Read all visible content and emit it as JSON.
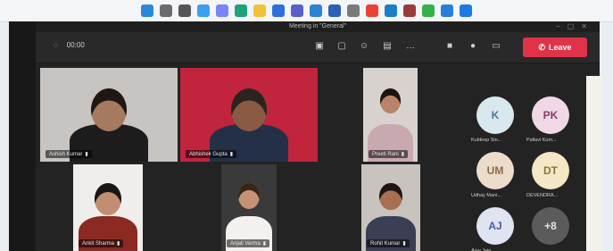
{
  "taskbar": {
    "icons": [
      {
        "name": "windows-icon",
        "color": "#2b88d8"
      },
      {
        "name": "search-icon",
        "color": "#6b6b6b"
      },
      {
        "name": "task-view-icon",
        "color": "#555555"
      },
      {
        "name": "widgets-icon",
        "color": "#3aa0f2"
      },
      {
        "name": "chat-icon",
        "color": "#7a86f5"
      },
      {
        "name": "edge-icon",
        "color": "#1ea27a"
      },
      {
        "name": "file-explorer-icon",
        "color": "#f2c13a"
      },
      {
        "name": "store-icon",
        "color": "#2f6fd8"
      },
      {
        "name": "teams-icon",
        "color": "#5a5fc8"
      },
      {
        "name": "mail-icon",
        "color": "#2c82d6"
      },
      {
        "name": "word-icon",
        "color": "#2b5fb8"
      },
      {
        "name": "settings-icon",
        "color": "#7a7a7a"
      },
      {
        "name": "chrome-icon",
        "color": "#e94235"
      },
      {
        "name": "photos-icon",
        "color": "#1b7fc4"
      },
      {
        "name": "app-icon",
        "color": "#9b3a3a"
      },
      {
        "name": "whatsapp-icon",
        "color": "#34b24a"
      },
      {
        "name": "media-icon",
        "color": "#2680d8"
      },
      {
        "name": "maps-icon",
        "color": "#1c7be0"
      }
    ]
  },
  "window": {
    "title": "Meeting in \"General\"",
    "timer": "00:00",
    "leave_label": "Leave"
  },
  "participants": [
    {
      "name": "Ashish Kumar",
      "skin": "#a57a5e",
      "hair": "#1e1714",
      "shirt": "#1c1c1c",
      "bg": "#c7c4c2"
    },
    {
      "name": "Abhishek Gupta",
      "skin": "#8a5a44",
      "hair": "#2a2420",
      "shirt": "#243048",
      "bg": "#c1243d"
    },
    {
      "name": "Preeti Rani",
      "skin": "#b98368",
      "hair": "#1c1410",
      "shirt": "#c9a9b0",
      "bg": "#d8d2cf"
    },
    {
      "name": "Ankit Sharma",
      "skin": "#c28e73",
      "hair": "#1a1614",
      "shirt": "#8a2a22",
      "bg": "#f0eeec"
    },
    {
      "name": "Anjali Verma",
      "skin": "#c59276",
      "hair": "#3a2619",
      "shirt": "#f3f0ee",
      "bg": "#3a3a3a"
    },
    {
      "name": "Rohit Kumar",
      "skin": "#a86f52",
      "hair": "#1d1714",
      "shirt": "#3a3f56",
      "bg": "#c9c3bf"
    }
  ],
  "roster": [
    {
      "initials": "K",
      "label": "Kuldeep Sin...",
      "bg": "#d9e7ef",
      "fg": "#4a7a96"
    },
    {
      "initials": "PK",
      "label": "Pallavi Kum...",
      "bg": "#f0d8e6",
      "fg": "#8a3d6b"
    },
    {
      "initials": "UM",
      "label": "Udhay Mani...",
      "bg": "#ecdccc",
      "fg": "#8a6a46"
    },
    {
      "initials": "DT",
      "label": "DEVENDRA...",
      "bg": "#f3e7c6",
      "fg": "#8a7436"
    },
    {
      "initials": "AJ",
      "label": "Ajay Jain",
      "bg": "#dfe3f2",
      "fg": "#4d5aa0"
    },
    {
      "initials": "+8",
      "label": "",
      "bg": "#5b5b5b",
      "fg": "#e6e6e6"
    }
  ]
}
